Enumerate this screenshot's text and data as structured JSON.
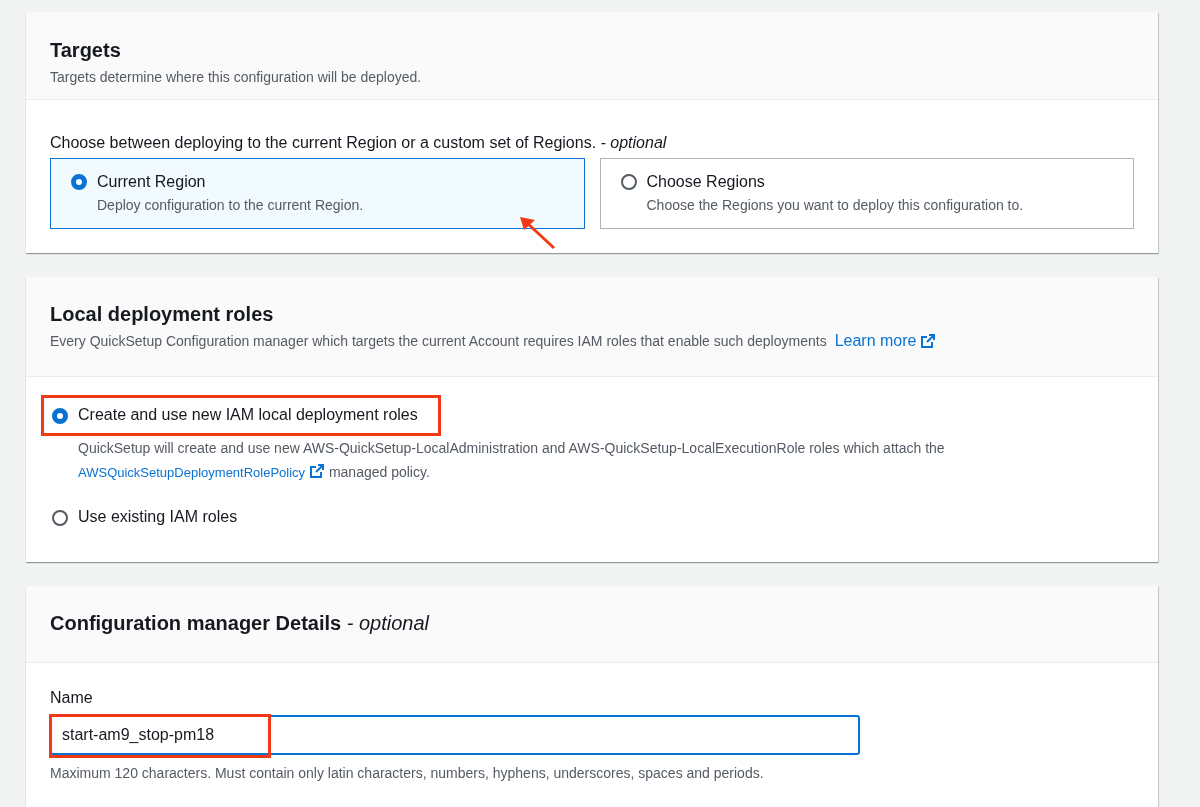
{
  "targets": {
    "title": "Targets",
    "description": "Targets determine where this configuration will be deployed.",
    "question": "Choose between deploying to the current Region or a custom set of Regions.",
    "question_suffix": "- optional",
    "tiles": [
      {
        "label": "Current Region",
        "description": "Deploy configuration to the current Region.",
        "selected": true,
        "annotated": true
      },
      {
        "label": "Choose Regions",
        "description": "Choose the Regions you want to deploy this configuration to.",
        "selected": false,
        "annotated": false
      }
    ]
  },
  "roles": {
    "title": "Local deployment roles",
    "description": "Every QuickSetup Configuration manager which targets the current Account requires IAM roles that enable such deployments",
    "learn_more": "Learn more",
    "options": [
      {
        "label": "Create and use new IAM local deployment roles",
        "selected": true,
        "highlighted": true,
        "description": "QuickSetup will create and use new AWS-QuickSetup-LocalAdministration and AWS-QuickSetup-LocalExecutionRole roles which attach the",
        "policy_link": "AWSQuickSetupDeploymentRolePolicy",
        "description_end": "managed policy."
      },
      {
        "label": "Use existing IAM roles",
        "selected": false,
        "highlighted": false
      }
    ]
  },
  "details": {
    "title": "Configuration manager Details",
    "title_suffix": "- optional",
    "name_label": "Name",
    "name_value": "start-am9_stop-pm18",
    "name_highlighted": true,
    "name_hint": "Maximum 120 characters. Must contain only latin characters, numbers, hyphens, underscores, spaces and periods."
  }
}
